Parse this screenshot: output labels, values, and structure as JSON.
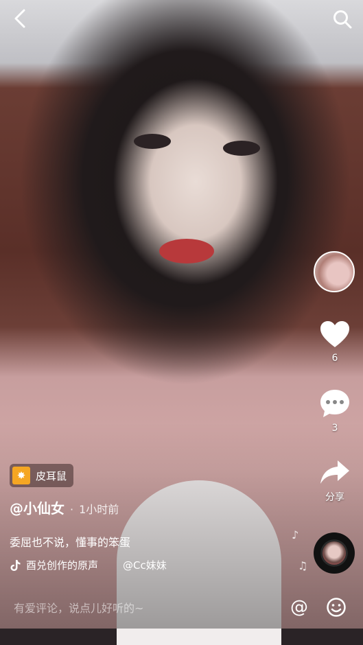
{
  "effect": {
    "icon": "sparkle-icon",
    "label": "皮耳鼠"
  },
  "author": {
    "name": "@小仙女",
    "separator": "·",
    "time": "1小时前"
  },
  "caption": "委屈也不说，懂事的笨蛋",
  "music": {
    "icon": "tiktok-note-icon",
    "title": "酉兑创作的原声",
    "credit": "@Cc妹妹"
  },
  "actions": {
    "like_count": "6",
    "comment_count": "3",
    "share_label": "分享"
  },
  "comment_bar": {
    "placeholder": "有爱评论，说点儿好听的~",
    "at_symbol": "@"
  }
}
